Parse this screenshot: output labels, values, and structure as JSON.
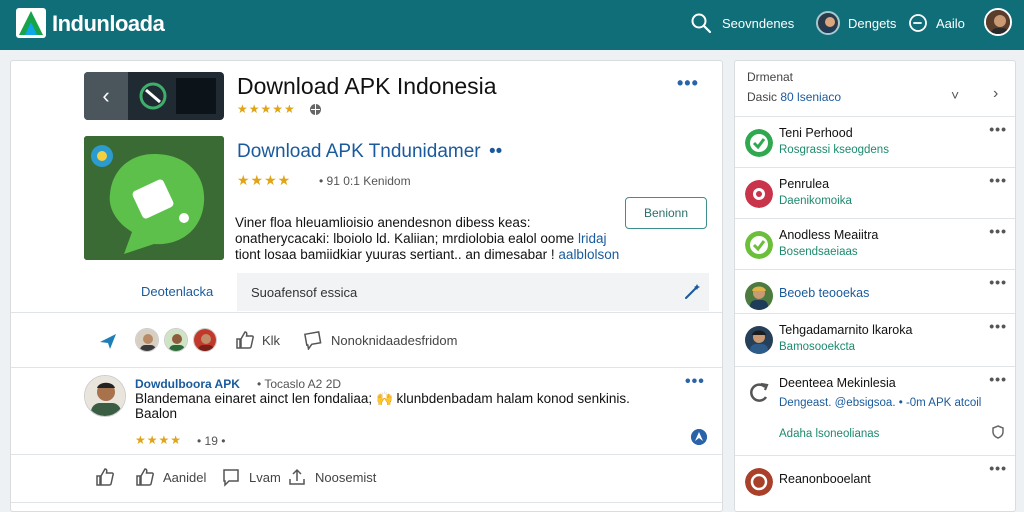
{
  "header": {
    "brand": "Indunloada",
    "search_label": "Seovndenes",
    "user_label": "Dengets",
    "clock_label": "Aailo"
  },
  "main": {
    "title": "Download APK Indonesia",
    "title_stars": "★★★★★",
    "title_more": "•••",
    "app": {
      "name": "Download APK Tndunidamer",
      "name_more": "••",
      "stars": "★★★★",
      "rating_text": "• 91 0:1 Kenidom",
      "download_label": "Benionn",
      "description_1": "Viner floa hleuamlioisio anendesnon dibess keas: onatherycacaki: lboiolo ld. Kaliian; mrdiolobia ealol oome",
      "description_link_1": "lridaj",
      "description_2": "tiont losaa bamiidkiar yuuras sertiant.. an dimesabar !",
      "description_link_2": "aalblolson"
    },
    "tabs": {
      "active": "Deotenlacka",
      "field": "Suoafensof essica"
    },
    "reactions": {
      "like_label": "Klk",
      "comment_label": "Nonoknidaadesfridom"
    },
    "post": {
      "author": "Dowdulboora APK",
      "time": "• Tocaslo A2 2D",
      "more": "•••",
      "text_1": "Blandemana einaret ainct len fondaliaa;",
      "emoji": "🙌",
      "text_2": "klunbdenbadam halam konod senkinis. Baalon",
      "stars": "★★★★",
      "count": "• 19 •"
    },
    "actions": [
      {
        "label": ""
      },
      {
        "label": "Aanidel"
      },
      {
        "label": "Lvam"
      },
      {
        "label": "Noosemist"
      }
    ]
  },
  "side": {
    "title": "Drmenat",
    "sub_prefix": "Dasic",
    "sub_accent": "80 lseniaco",
    "items": [
      {
        "title": "Teni Perhood",
        "sub": "Rosgrassi kseogdens",
        "more": "•••",
        "color": "#2fa84f"
      },
      {
        "title": "Penrulea",
        "sub": "Daenikomoika",
        "more": "•••",
        "color": "#c9344a"
      },
      {
        "title": "Anodless Meaiitra",
        "sub": "Bosendsaeiaas",
        "more": "•••",
        "color": "#6bbf3a"
      },
      {
        "title": "Beoeb teooekas",
        "sub": "",
        "more": "•••",
        "color": "#3d6b3a"
      },
      {
        "title": "Tehgadamarnito lkaroka",
        "sub": "Bamosooekcta",
        "more": "•••",
        "color": "#27405a"
      },
      {
        "title": "Deenteea Mekinlesia",
        "extra": "Dengeast. @ebsigsoa. • -0m APK atcoil",
        "extra2": "Adaha lsoneolianas",
        "more": "•••",
        "color": "#555555"
      },
      {
        "title": "Reanonbooelant",
        "sub": "",
        "more": "•••",
        "color": "#a8402a"
      }
    ]
  },
  "colors": {
    "topbar": "#0f6e78",
    "link": "#1a5a9c",
    "accent_green": "#1d8a6d",
    "star": "#e0a417"
  }
}
